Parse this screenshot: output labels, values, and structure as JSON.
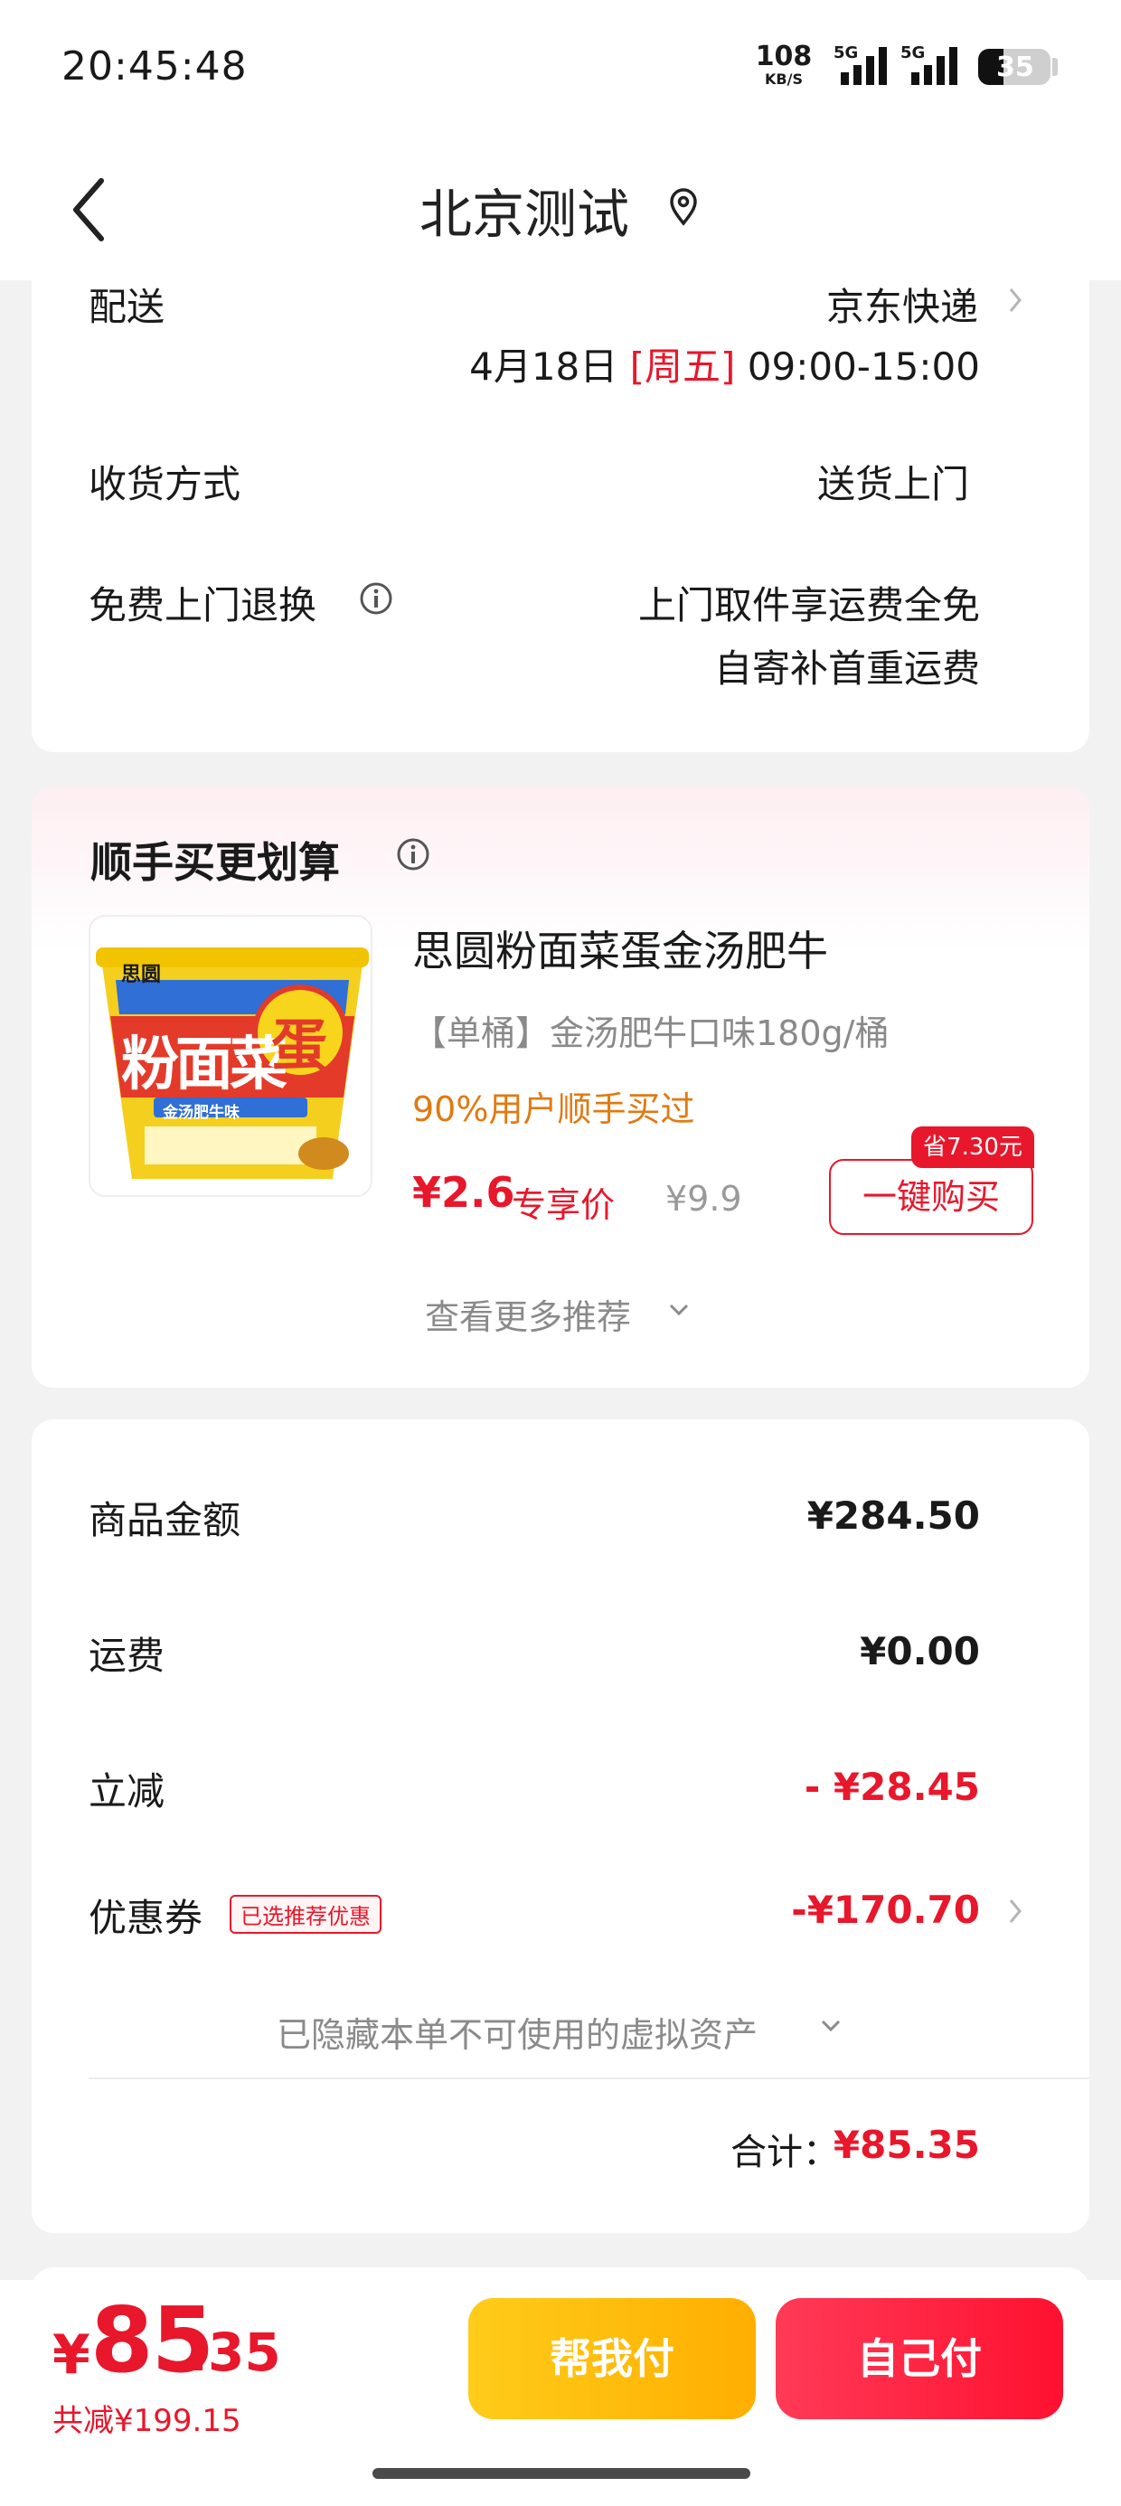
{
  "status_bar": {
    "time": "20:45:48",
    "net_speed": "108",
    "net_unit": "KB/S",
    "signal1_tag": "5G",
    "signal2_tag": "5G",
    "battery": "35"
  },
  "nav": {
    "title": "北京测试"
  },
  "delivery": {
    "shipping_label": "配送",
    "shipping_method": "京东快递",
    "date": "4月18日",
    "weekday": "[周五]",
    "time_window": "09:00-15:00",
    "receive_label": "收货方式",
    "receive_value": "送货上门",
    "return_label": "免费上门退换",
    "return_line1": "上门取件享运费全免",
    "return_line2": "自寄补首重运费"
  },
  "recommendation": {
    "title": "顺手买更划算",
    "product_name": "思圆粉面菜蛋金汤肥牛",
    "product_spec": "【单桶】金汤肥牛口味180g/桶",
    "buy_rate": "90%用户顺手买过",
    "price": "¥2.6",
    "price_tag": "专享价",
    "original_price": "¥9.9",
    "save_badge": "省7.30元",
    "buy_button": "一键购买",
    "more": "查看更多推荐",
    "image_text": {
      "brand": "思圆",
      "title": "粉面菜",
      "egg": "蛋",
      "flavor": "金汤肥牛味"
    }
  },
  "summary": {
    "rows": [
      {
        "label": "商品金额",
        "value": "¥284.50"
      },
      {
        "label": "运费",
        "value": "¥0.00"
      },
      {
        "label": "立减",
        "value": "- ¥28.45"
      },
      {
        "label": "优惠券",
        "value": "-¥170.70"
      }
    ],
    "coupon_badge": "已选推荐优惠",
    "hidden_assets": "已隐藏本单不可使用的虚拟资产",
    "total_label": "合计：",
    "total_value": "¥85.35"
  },
  "footer": {
    "currency": "¥",
    "amount_int": "85",
    "amount_dec": ".35",
    "saved": "共减¥199.15",
    "help_pay": "帮我付",
    "self_pay": "自己付"
  },
  "colors": {
    "accent_red": "#e8172b",
    "orange_text": "#e07a12",
    "help_pay": "#ffbb0d",
    "self_pay": "#ff2540"
  }
}
